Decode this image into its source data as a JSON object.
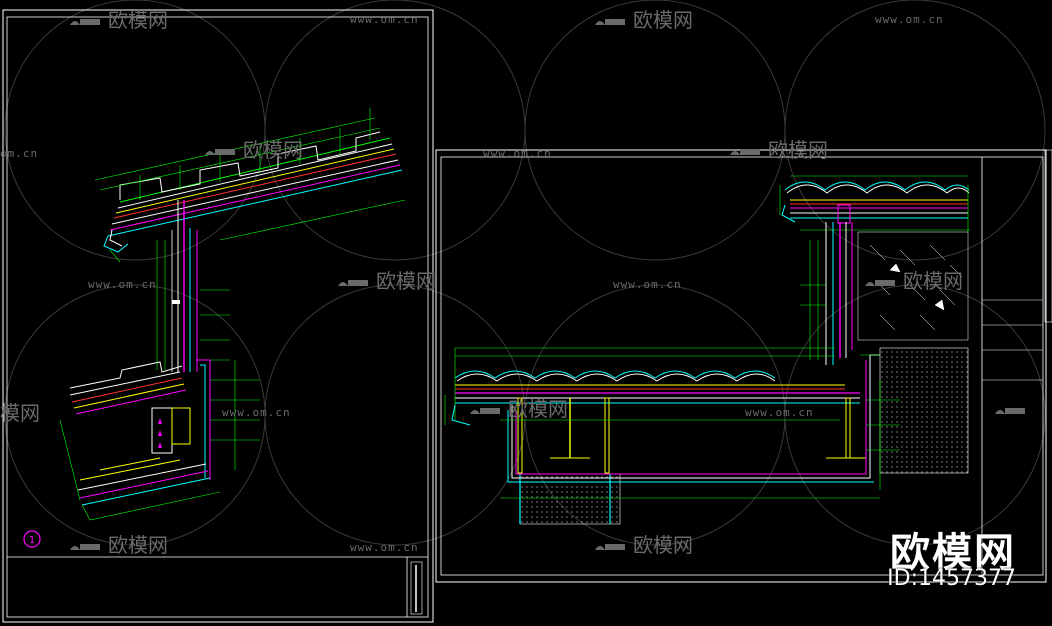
{
  "watermark": {
    "logo_text": "欧模网",
    "url_text": "www.om.cn",
    "partial_url": "om.cn",
    "partial_logo": "模网"
  },
  "brand": {
    "title": "欧模网",
    "id_label": "ID:1457377"
  },
  "sheet_left": {
    "section_marker": "1"
  },
  "colors": {
    "background": "#000000",
    "frame": "#ffffff",
    "magenta": "#ff00ff",
    "green": "#00ff00",
    "cyan": "#00ffff",
    "yellow": "#ffff00",
    "red": "#ff3030",
    "watermark": "#6a6a6a"
  }
}
